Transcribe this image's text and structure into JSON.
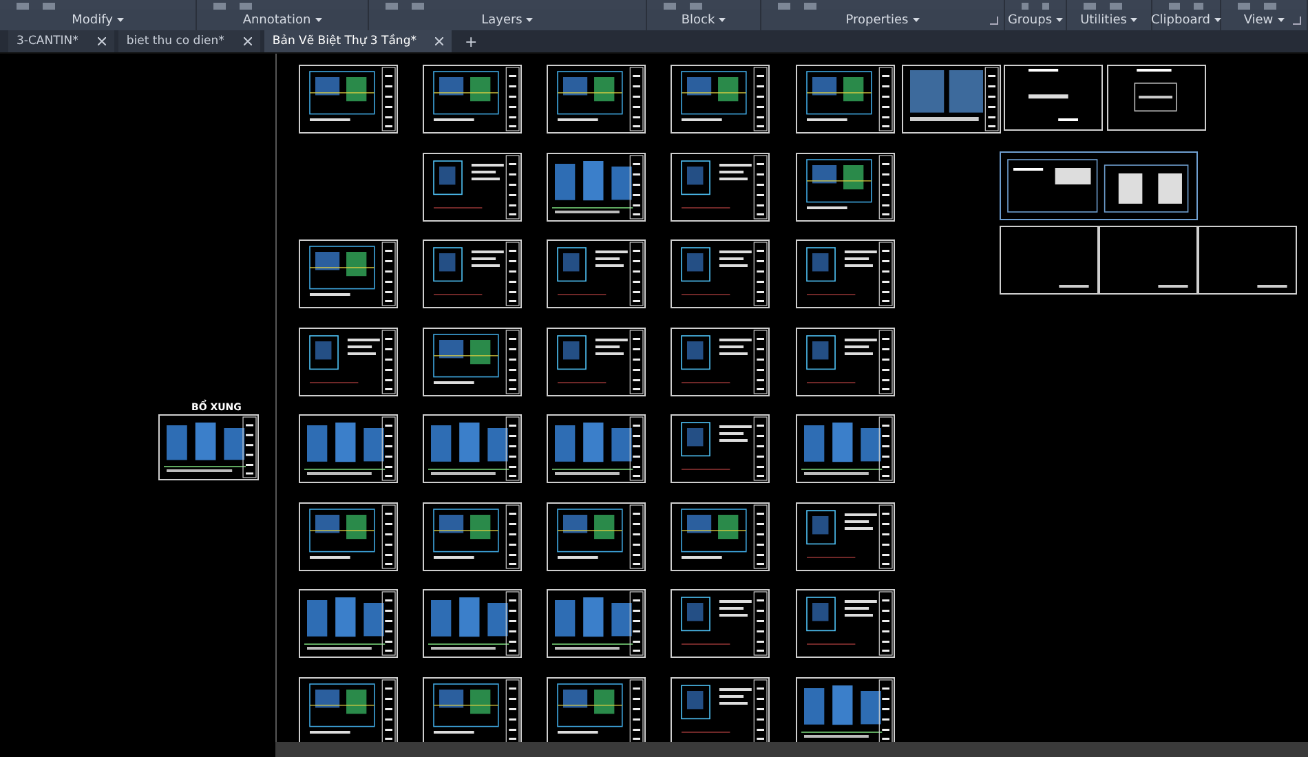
{
  "ribbon_panels": [
    {
      "label": "Modify",
      "launcher": false
    },
    {
      "label": "Annotation",
      "launcher": false
    },
    {
      "label": "Layers",
      "launcher": false
    },
    {
      "label": "Block",
      "launcher": false
    },
    {
      "label": "Properties",
      "launcher": true
    },
    {
      "label": "Groups",
      "launcher": false
    },
    {
      "label": "Utilities",
      "launcher": false
    },
    {
      "label": "Clipboard",
      "launcher": false
    },
    {
      "label": "View",
      "launcher": true
    }
  ],
  "tabs": [
    {
      "label": "3-CANTIN*",
      "selected": false
    },
    {
      "label": "biet thu co dien*",
      "selected": false
    },
    {
      "label": "Bản Vẽ Biệt Thự 3 Tầng*",
      "selected": true
    }
  ],
  "new_tab": "+",
  "extra_sheet": {
    "caption": "BỔ XUNG",
    "kind": "elevation"
  },
  "sheet_rows": [
    {
      "sheets": [
        {
          "kind": "plan"
        },
        {
          "kind": "plan"
        },
        {
          "kind": "plan"
        },
        {
          "kind": "plan"
        },
        {
          "kind": "plan"
        }
      ]
    },
    {
      "sheets": [
        {
          "kind": "none"
        },
        {
          "kind": "detail"
        },
        {
          "kind": "elevation"
        },
        {
          "kind": "detail"
        },
        {
          "kind": "plan"
        }
      ]
    },
    {
      "sheets": [
        {
          "kind": "plan"
        },
        {
          "kind": "detail"
        },
        {
          "kind": "detail"
        },
        {
          "kind": "detail"
        },
        {
          "kind": "detail"
        }
      ]
    },
    {
      "sheets": [
        {
          "kind": "detail"
        },
        {
          "kind": "plan"
        },
        {
          "kind": "detail"
        },
        {
          "kind": "detail"
        },
        {
          "kind": "detail"
        }
      ]
    },
    {
      "sheets": [
        {
          "kind": "elevation"
        },
        {
          "kind": "elevation"
        },
        {
          "kind": "elevation"
        },
        {
          "kind": "detail"
        },
        {
          "kind": "elevation"
        }
      ]
    },
    {
      "sheets": [
        {
          "kind": "plan"
        },
        {
          "kind": "plan"
        },
        {
          "kind": "plan"
        },
        {
          "kind": "plan"
        },
        {
          "kind": "detail"
        }
      ]
    },
    {
      "sheets": [
        {
          "kind": "elevation"
        },
        {
          "kind": "elevation"
        },
        {
          "kind": "elevation"
        },
        {
          "kind": "detail"
        },
        {
          "kind": "detail"
        }
      ]
    },
    {
      "sheets": [
        {
          "kind": "plan"
        },
        {
          "kind": "plan"
        },
        {
          "kind": "plan"
        },
        {
          "kind": "detail"
        },
        {
          "kind": "elevation"
        }
      ]
    }
  ],
  "side_sheets": [
    {
      "kind": "schedule"
    },
    {
      "kind": "title"
    },
    {
      "kind": "cover"
    },
    {
      "kind": "notes"
    },
    {
      "kind": "blank"
    },
    {
      "kind": "blank"
    },
    {
      "kind": "blank"
    }
  ]
}
